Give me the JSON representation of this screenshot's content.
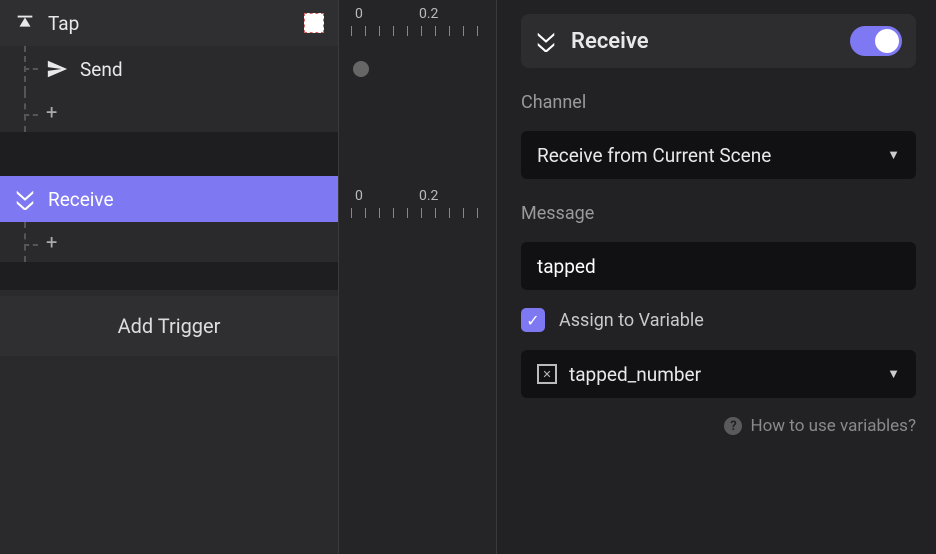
{
  "left": {
    "triggers": [
      {
        "label": "Tap",
        "kind": "tap"
      },
      {
        "label": "Send",
        "kind": "send",
        "child": true
      },
      {
        "label": "Receive",
        "kind": "receive",
        "selected": true
      }
    ],
    "add_trigger_label": "Add Trigger",
    "add_child_glyph": "+"
  },
  "timeline": {
    "ticks": [
      "0",
      "0.2"
    ]
  },
  "inspector": {
    "title": "Receive",
    "enabled": true,
    "channel_label": "Channel",
    "channel_value": "Receive from Current Scene",
    "message_label": "Message",
    "message_value": "tapped",
    "assign_checkbox_label": "Assign to Variable",
    "assign_checked": true,
    "variable_value": "tapped_number",
    "help_text": "How to use variables?"
  }
}
